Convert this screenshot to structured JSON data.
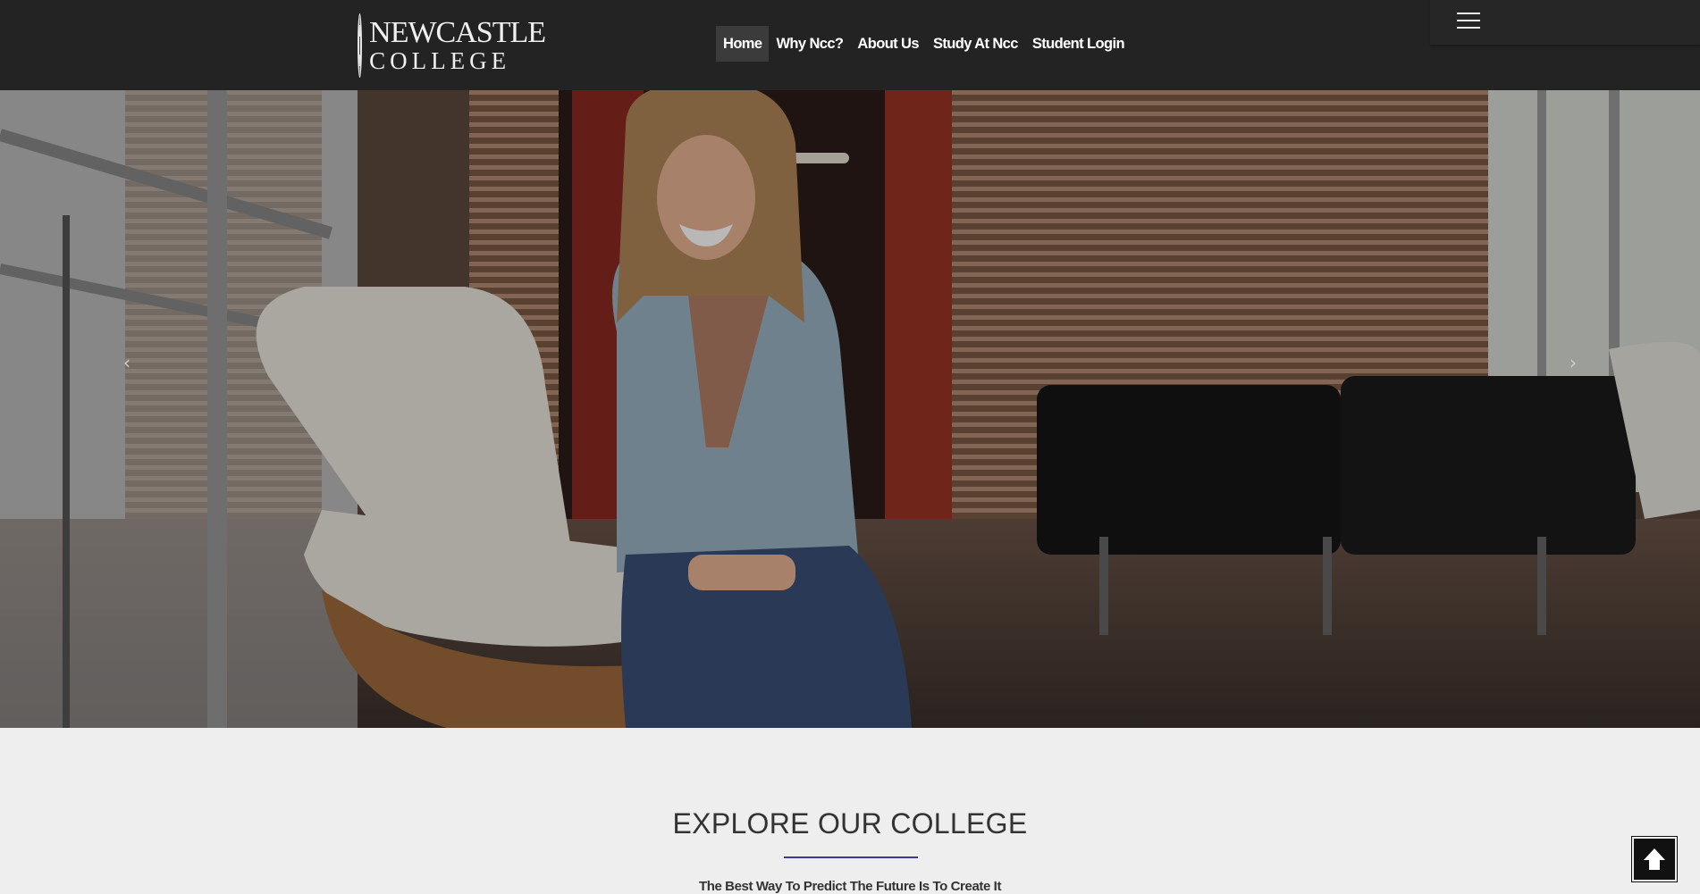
{
  "header": {
    "logo": {
      "line1": "NEWCASTLE",
      "line2": "COLLEGE",
      "icon": "college-crest-icon"
    },
    "nav": [
      {
        "label": "Home",
        "active": true
      },
      {
        "label": "Why Ncc?",
        "active": false
      },
      {
        "label": "About Us",
        "active": false
      },
      {
        "label": "Study At Ncc",
        "active": false
      },
      {
        "label": "Student Login",
        "active": false
      }
    ],
    "menu_icon": "hamburger-menu-icon"
  },
  "hero": {
    "prev_arrow": "‹",
    "next_arrow": "›",
    "image": "student-seated-in-lounge-photo"
  },
  "explore": {
    "title": "EXPLORE OUR COLLEGE",
    "tagline": "The Best Way To Predict The Future Is To Create It"
  },
  "colors": {
    "header_bg": "#232323",
    "accent_rule": "#3a3d8f",
    "page_bg": "#eeeeee"
  },
  "back_to_top_icon": "arrow-up-icon"
}
